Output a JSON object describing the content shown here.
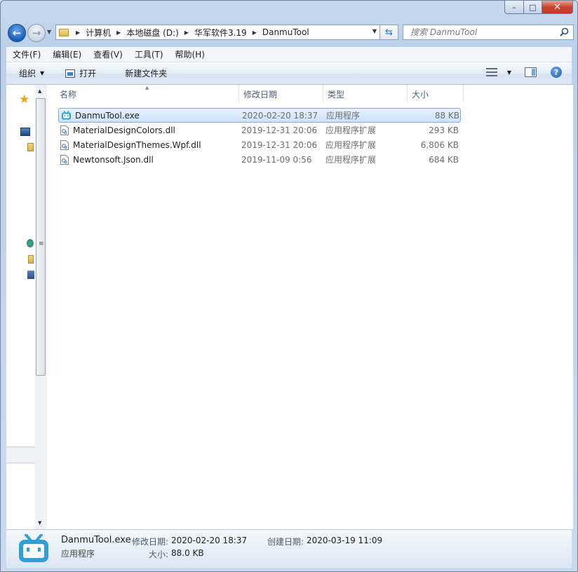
{
  "window": {
    "controls": {
      "minimize": "–",
      "maximize": "□",
      "close": "✕"
    }
  },
  "navigation": {
    "breadcrumbs": [
      "计算机",
      "本地磁盘 (D:)",
      "华军软件3.19",
      "DanmuTool"
    ],
    "search_placeholder": "搜索 DanmuTool"
  },
  "menubar": [
    "文件(F)",
    "编辑(E)",
    "查看(V)",
    "工具(T)",
    "帮助(H)"
  ],
  "commandbar": {
    "organize": "组织",
    "open": "打开",
    "new_folder": "新建文件夹"
  },
  "columns": {
    "name": "名称",
    "date": "修改日期",
    "type": "类型",
    "size": "大小"
  },
  "files": [
    {
      "name": "DanmuTool.exe",
      "date": "2020-02-20 18:37",
      "type": "应用程序",
      "size": "88 KB",
      "icon": "bilibili-app-icon",
      "selected": true
    },
    {
      "name": "MaterialDesignColors.dll",
      "date": "2019-12-31 20:06",
      "type": "应用程序扩展",
      "size": "293 KB",
      "icon": "dll-file-icon",
      "selected": false
    },
    {
      "name": "MaterialDesignThemes.Wpf.dll",
      "date": "2019-12-31 20:06",
      "type": "应用程序扩展",
      "size": "6,806 KB",
      "icon": "dll-file-icon",
      "selected": false
    },
    {
      "name": "Newtonsoft.Json.dll",
      "date": "2019-11-09 0:56",
      "type": "应用程序扩展",
      "size": "684 KB",
      "icon": "dll-file-icon",
      "selected": false
    }
  ],
  "details": {
    "filename": "DanmuTool.exe",
    "filetype": "应用程序",
    "modified_label": "修改日期:",
    "modified_value": "2020-02-20 18:37",
    "created_label": "创建日期:",
    "created_value": "2020-03-19 11:09",
    "size_label": "大小:",
    "size_value": "88.0 KB"
  },
  "colors": {
    "accent": "#2f9fd8",
    "selection": "#cce2fb",
    "selection_border": "#84acdd"
  }
}
